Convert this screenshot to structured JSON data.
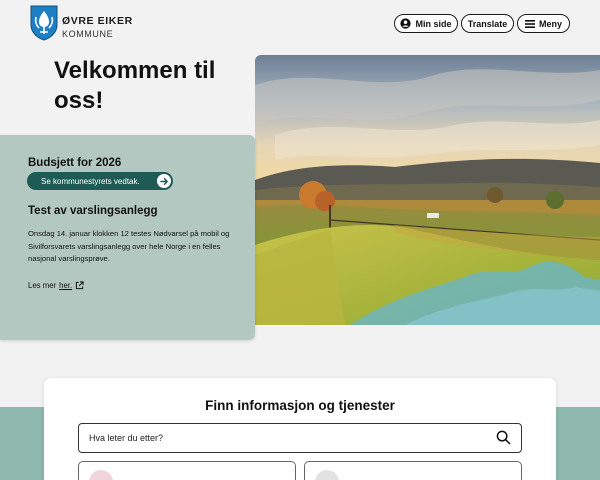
{
  "header": {
    "brand_line1": "ØVRE EIKER",
    "brand_line2": "KOMMUNE",
    "buttons": {
      "min_side": "Min side",
      "translate": "Translate",
      "meny": "Meny"
    }
  },
  "hero": {
    "title": "Velkommen til oss!"
  },
  "notice": {
    "budget_title": "Budsjett for 2026",
    "budget_button": "Se kommunestyrets vedtak.",
    "alarm_title": "Test av varslingsanlegg",
    "alarm_body": "Onsdag 14. januar klokken 12 testes Nødvarsel på mobil og Sivilforsvarets varslingsanlegg over hele Norge i en felles nasjonal varslingsprøve.",
    "read_more_prefix": "Les mer",
    "read_more_link": "her."
  },
  "search": {
    "heading": "Finn informasjon og tjenester",
    "placeholder": "Hva leter du etter?"
  },
  "icons": [
    "shield-logo-icon",
    "user-icon",
    "menu-icon",
    "arrow-right-icon",
    "external-link-icon",
    "search-icon"
  ],
  "colors": {
    "card_bg": "#b3c8c1",
    "button_teal": "#1f5b55",
    "band_teal": "#8fb9af",
    "logo_blue": "#1f7fc4"
  }
}
